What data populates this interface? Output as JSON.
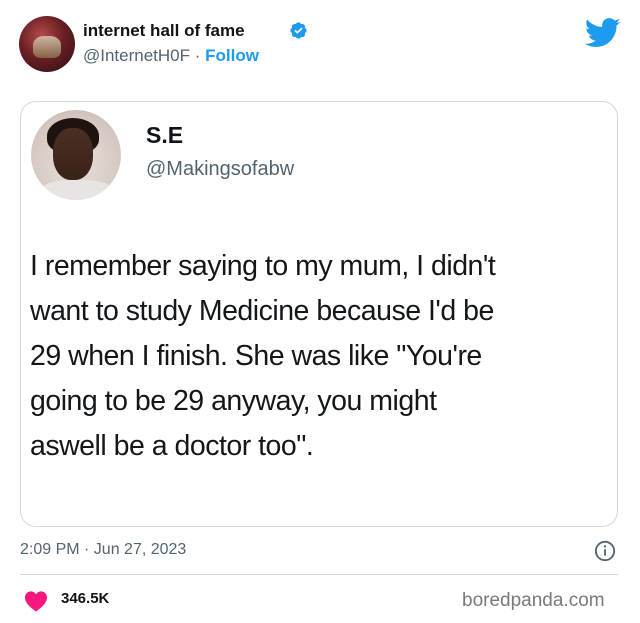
{
  "author": {
    "display_name": "internet hall of fame",
    "handle": "@InternetH0F",
    "separator": " · ",
    "follow_label": "Follow"
  },
  "quoted_tweet": {
    "name": "S.E",
    "handle": "@Makingsofabw",
    "lines": [
      "I remember saying to my mum, I didn't",
      "want to study Medicine because I'd be",
      "29 when I finish. She was like \"You're",
      "going to be 29 anyway, you might",
      "aswell be a doctor too\"."
    ]
  },
  "meta": {
    "timestamp": "2:09 PM · Jun 27, 2023",
    "like_count": "346.5K"
  },
  "watermark": "boredpanda.com",
  "colors": {
    "accent": "#1d9bf0",
    "heart": "#f91880",
    "secondary_text": "#536471",
    "border": "#cfd9de"
  },
  "icons": [
    "verified-badge-icon",
    "twitter-bird-icon",
    "info-icon",
    "heart-icon"
  ]
}
